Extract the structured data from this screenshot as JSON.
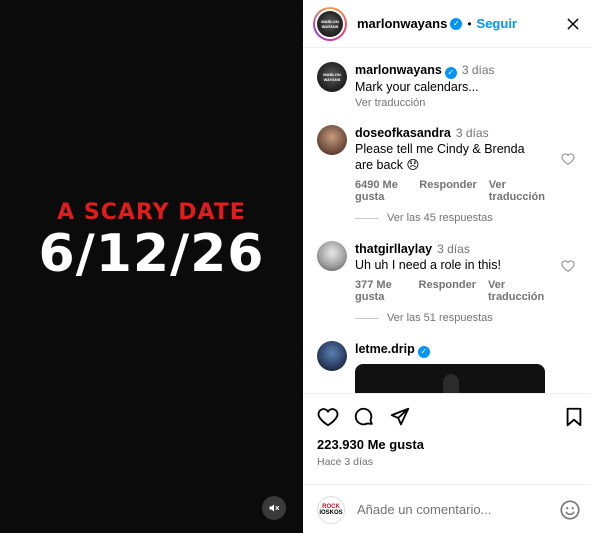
{
  "media": {
    "title": "A SCARY DATE",
    "date": "6/12/26"
  },
  "header": {
    "username": "marlonwayans",
    "follow_label": "Seguir",
    "avatar_text": "MARLON WAYANS"
  },
  "caption": {
    "username": "marlonwayans",
    "time": "3 días",
    "text": "Mark your calendars...",
    "translate": "Ver traducción"
  },
  "comments": [
    {
      "username": "doseofkasandra",
      "time": "3 días",
      "text": "Please tell me Cindy & Brenda are back 😞",
      "likes": "6490 Me gusta",
      "reply": "Responder",
      "translate": "Ver traducción",
      "replies": "Ver las 45 respuestas"
    },
    {
      "username": "thatgirllaylay",
      "time": "3 días",
      "text": "Uh uh I need a role in this!",
      "likes": "377 Me gusta",
      "reply": "Responder",
      "translate": "Ver traducción",
      "replies": "Ver las 51 respuestas"
    },
    {
      "username": "letme.drip"
    }
  ],
  "footer": {
    "likes": "223.930 Me gusta",
    "posted": "Hace 3 días",
    "add_comment_placeholder": "Añade un comentario...",
    "my_avatar_top": "ROCK",
    "my_avatar_bottom": "IOSKOS"
  },
  "colors": {
    "accent": "#0095f6",
    "media_bg": "#0b0b0b",
    "title_red": "#e01c1c",
    "muted": "#737373"
  }
}
